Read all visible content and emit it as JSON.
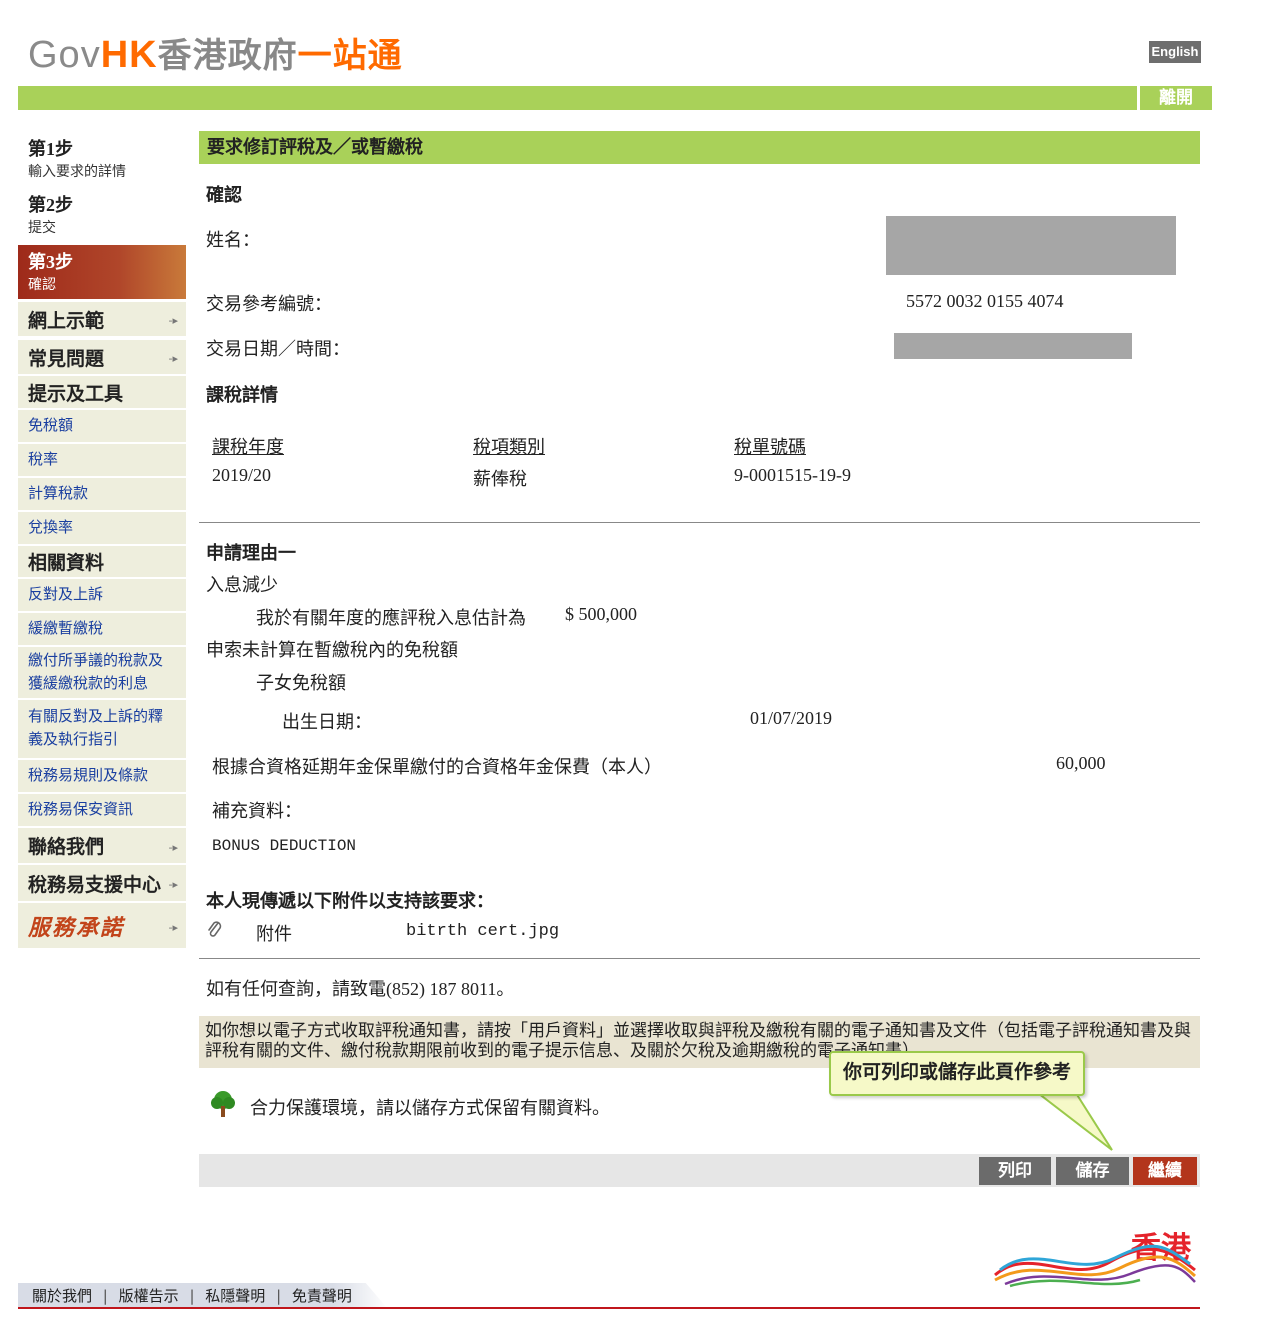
{
  "header": {
    "logo_gov": "Gov",
    "logo_hk": "HK",
    "logo_cn_1": "香港政府",
    "logo_cn_2": "一站通",
    "english_label": "English",
    "exit_label": "離開"
  },
  "steps": [
    {
      "title": "第1步",
      "subtitle": "輸入要求的詳情"
    },
    {
      "title": "第2步",
      "subtitle": "提交"
    },
    {
      "title": "第3步",
      "subtitle": "確認"
    }
  ],
  "nav": {
    "demo": "網上示範",
    "faq": "常見問題",
    "tips_header": "提示及工具",
    "allowances": "免稅額",
    "tax_rates": "稅率",
    "calc": "計算稅款",
    "exchange": "兌換率",
    "related_header": "相關資料",
    "objection": "反對及上訴",
    "holdover": "緩繳暫繳稅",
    "disputed_line1": "繳付所爭議的稅款及",
    "disputed_line2": "獲緩繳稅款的利息",
    "guide_line1": "有關反對及上訴的釋",
    "guide_line2": "義及執行指引",
    "eta_rules": "稅務易規則及條款",
    "eta_security": "稅務易保安資訊",
    "contact": "聯絡我們",
    "support": "稅務易支援中心",
    "pledge": "服務承諾"
  },
  "main": {
    "title": "要求修訂評稅及／或暫繳稅",
    "confirm_header": "確認",
    "name_label": "姓名：",
    "ref_label": "交易參考編號：",
    "ref_value": "5572 0032 0155 4074",
    "datetime_label": "交易日期／時間：",
    "tax_details_header": "課稅詳情",
    "table": {
      "headers": [
        "課稅年度",
        "稅項類別",
        "稅單號碼"
      ],
      "row": [
        "2019/20",
        "薪俸稅",
        "9-0001515-19-9"
      ]
    },
    "reason_header": "申請理由一",
    "reason_1": "入息減少",
    "income_estimate_label": "我於有關年度的應評稅入息估計為",
    "income_estimate_value": "$ 500,000",
    "reason_2": "申索未計算在暫繳稅內的免稅額",
    "child_allowance": "子女免稅額",
    "dob_label": "出生日期：",
    "dob_value": "01/07/2019",
    "annuity_label": "根據合資格延期年金保單繳付的合資格年金保費（本人）",
    "annuity_value": "60,000",
    "supplement_label": "補充資料：",
    "supplement_value": "BONUS DEDUCTION",
    "attachment_header": "本人現傳遞以下附件以支持該要求：",
    "attachment_label": "附件",
    "attachment_file": "bitrth cert.jpg",
    "enquiry": "如有任何查詢，請致電(852) 187 8011。",
    "e_notice": "如你想以電子方式收取評稅通知書，請按「用戶資料」並選擇收取與評稅及繳稅有關的電子通知書及文件（包括電子評稅通知書及與評稅有關的文件、繳付稅款期限前收到的電子提示信息、及關於欠稅及逾期繳稅的電子通知書）。",
    "tooltip": "你可列印或儲存此頁作參考",
    "green_msg": "合力保護環境，請以儲存方式保留有關資料。",
    "btn_print": "列印",
    "btn_save": "儲存",
    "btn_continue": "繼續"
  },
  "footer": {
    "about": "關於我們",
    "copyright": "版權告示",
    "privacy": "私隱聲明",
    "disclaimer": "免責聲明",
    "separator": "|",
    "brand": "香港"
  }
}
